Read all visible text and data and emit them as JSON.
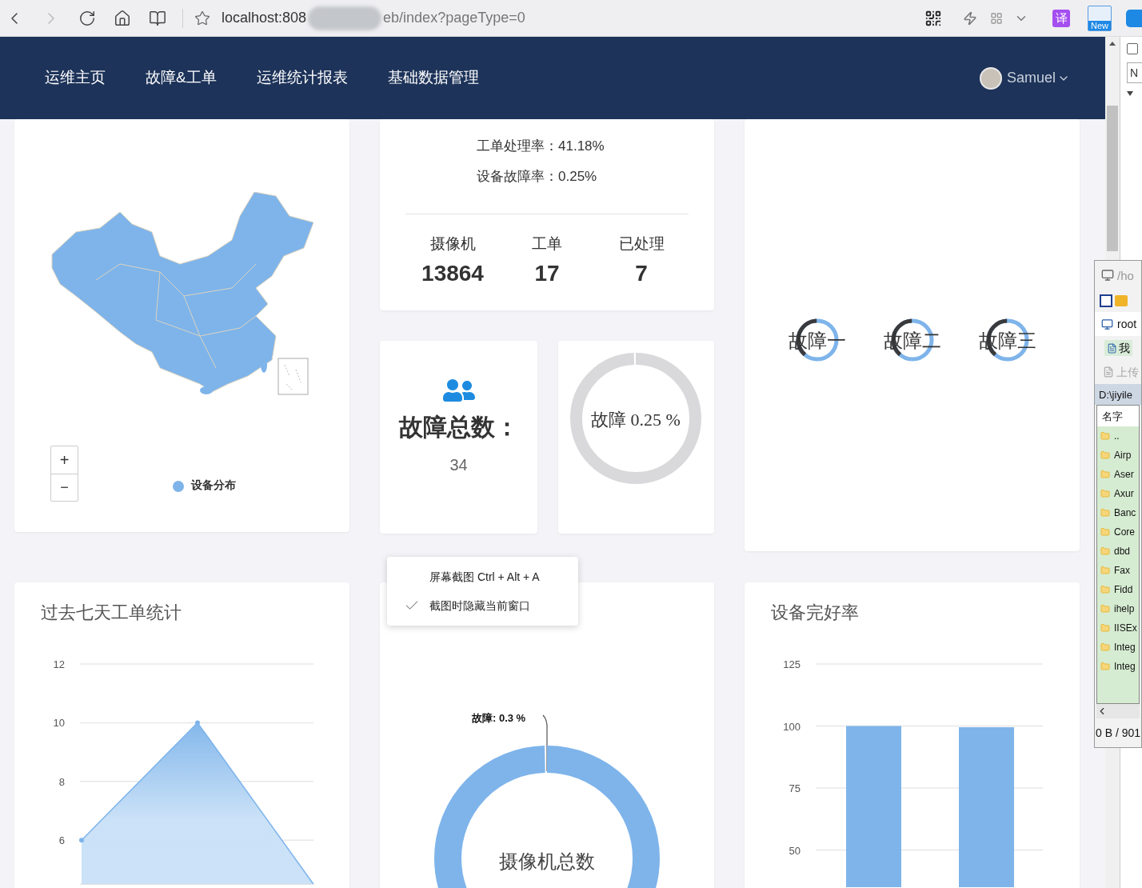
{
  "browser": {
    "url_host": "localhost:808",
    "url_path": "eb/index?pageType=0",
    "translate_label": "译",
    "new_badge": "New"
  },
  "nav": {
    "items": [
      {
        "label": "运维主页"
      },
      {
        "label": "故障&工单"
      },
      {
        "label": "运维统计报表"
      },
      {
        "label": "基础数据管理"
      }
    ],
    "user": {
      "name": "Samuel"
    }
  },
  "map_card": {
    "zoom_in": "+",
    "zoom_out": "−",
    "legend": "设备分布"
  },
  "rates": [
    {
      "label": "工单处理率：",
      "value": "41.18%"
    },
    {
      "label": "设备故障率：",
      "value": "0.25%"
    }
  ],
  "stats": [
    {
      "label": "摄像机",
      "value": "13864"
    },
    {
      "label": "工单",
      "value": "17"
    },
    {
      "label": "已处理",
      "value": "7"
    }
  ],
  "fault_total": {
    "title": "故障总数：",
    "value": "34"
  },
  "fault_ratio": {
    "label": "故障 0.25 %"
  },
  "gauges": [
    {
      "label": "故障一"
    },
    {
      "label": "故障二"
    },
    {
      "label": "故障三"
    }
  ],
  "work_orders_chart": {
    "title": "过去七天工单统计",
    "chart_data": {
      "type": "area",
      "values": [
        6,
        10,
        4.5
      ],
      "ylim": [
        4.5,
        12
      ],
      "yticks": [
        6,
        8,
        10,
        12
      ],
      "grid": true
    }
  },
  "camera_chart": {
    "slice_label": "故障: 0.3 %",
    "center_label": "摄像机总数"
  },
  "device_chart": {
    "title": "设备完好率",
    "chart_data": {
      "type": "bar",
      "values": [
        100,
        99.5
      ],
      "ylim": [
        35,
        125
      ],
      "yticks": [
        50,
        75,
        100,
        125
      ],
      "grid": true
    }
  },
  "context_menu": {
    "items": [
      {
        "label": "屏幕截图 Ctrl + Alt + A",
        "checked": false
      },
      {
        "label": "截图时隐藏当前窗口",
        "checked": true
      }
    ]
  },
  "side_window": {
    "path": "/ho",
    "user": "root",
    "tab": "我",
    "upload": "上传",
    "local_path": "D:\\jiyile",
    "column": "名字",
    "files": [
      {
        "name": ".."
      },
      {
        "name": "Airp"
      },
      {
        "name": "Aser"
      },
      {
        "name": "Axur"
      },
      {
        "name": "Banc"
      },
      {
        "name": "Core"
      },
      {
        "name": "dbd"
      },
      {
        "name": "Fax"
      },
      {
        "name": "Fidd"
      },
      {
        "name": "ihelp"
      },
      {
        "name": "IISEx"
      },
      {
        "name": "Integ"
      },
      {
        "name": "Integ"
      }
    ],
    "status": "0 B / 901"
  },
  "devtools": {
    "field": "N"
  }
}
